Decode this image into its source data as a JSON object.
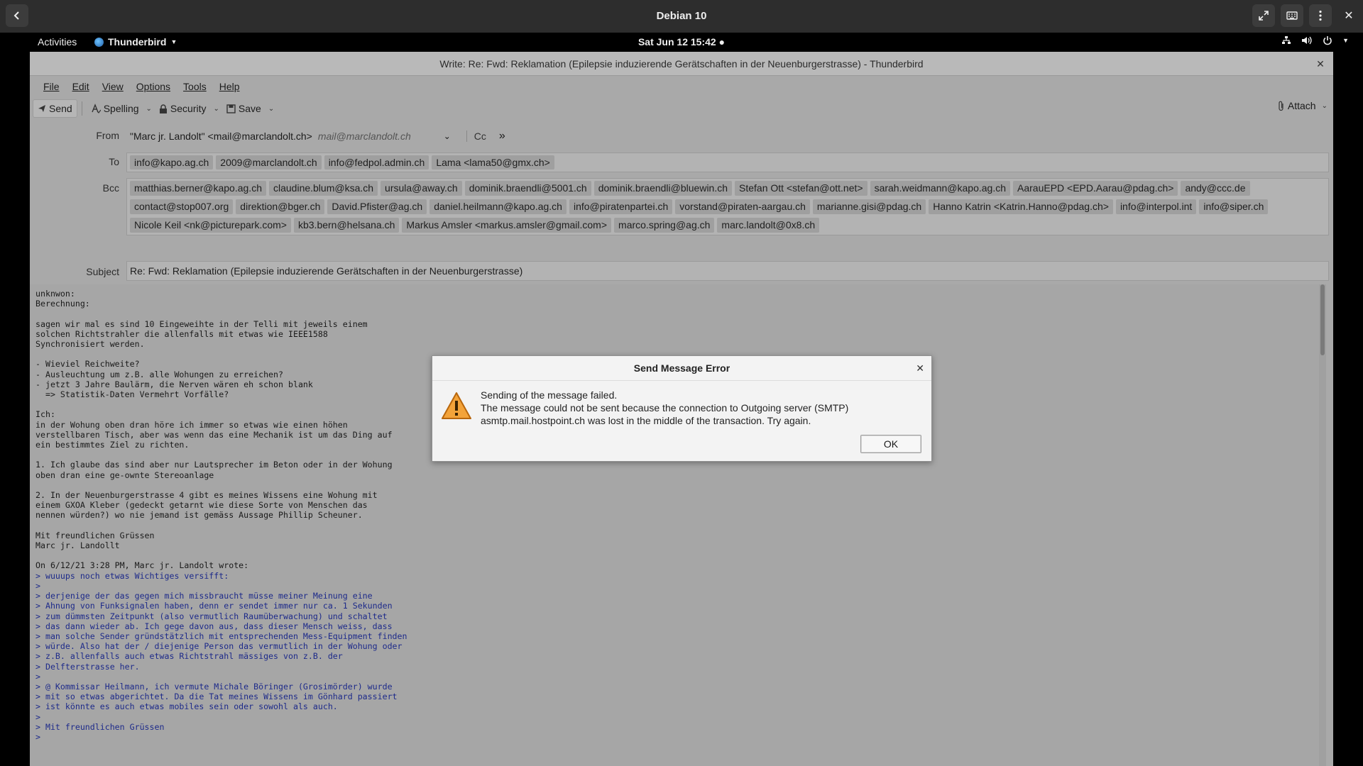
{
  "vm": {
    "title": "Debian 10"
  },
  "panel": {
    "activities": "Activities",
    "app": "Thunderbird",
    "clock": "Sat Jun 12  15:42"
  },
  "window": {
    "title": "Write: Re: Fwd: Reklamation (Epilepsie induzierende Gerätschaften in der Neuenburgerstrasse) - Thunderbird"
  },
  "menu": [
    "File",
    "Edit",
    "View",
    "Options",
    "Tools",
    "Help"
  ],
  "toolbar": {
    "send": "Send",
    "spelling": "Spelling",
    "security": "Security",
    "save": "Save",
    "attach": "Attach"
  },
  "headers": {
    "from_label": "From",
    "from_value": "\"Marc jr. Landolt\" <mail@marclandolt.ch>",
    "from_alt": "mail@marclandolt.ch",
    "cc": "Cc",
    "to_label": "To",
    "to": [
      "info@kapo.ag.ch",
      "2009@marclandolt.ch",
      "info@fedpol.admin.ch",
      "Lama <lama50@gmx.ch>"
    ],
    "bcc_label": "Bcc",
    "bcc": [
      "matthias.berner@kapo.ag.ch",
      "claudine.blum@ksa.ch",
      "ursula@away.ch",
      "dominik.braendli@5001.ch",
      "dominik.braendli@bluewin.ch",
      "Stefan Ott <stefan@ott.net>",
      "sarah.weidmann@kapo.ag.ch",
      "AarauEPD <EPD.Aarau@pdag.ch>",
      "andy@ccc.de",
      "contact@stop007.org",
      "direktion@bger.ch",
      "David.Pfister@ag.ch",
      "daniel.heilmann@kapo.ag.ch",
      "info@piratenpartei.ch",
      "vorstand@piraten-aargau.ch",
      "marianne.gisi@pdag.ch",
      "Hanno Katrin <Katrin.Hanno@pdag.ch>",
      "info@interpol.int",
      "info@siper.ch",
      "Nicole Keil <nk@picturepark.com>",
      "kb3.bern@helsana.ch",
      "Markus Amsler <markus.amsler@gmail.com>",
      "marco.spring@ag.ch",
      "marc.landolt@0x8.ch"
    ],
    "subject_label": "Subject",
    "subject": "Re: Fwd: Reklamation (Epilepsie induzierende Gerätschaften in der Neuenburgerstrasse)"
  },
  "body": {
    "plain": [
      "unknwon:",
      "Berechnung:",
      "",
      "sagen wir mal es sind 10 Eingeweihte in der Telli mit jeweils einem",
      "solchen Richtstrahler die allenfalls mit etwas wie IEEE1588",
      "Synchronisiert werden.",
      "",
      "- Wieviel Reichweite?",
      "- Ausleuchtung um z.B. alle Wohungen zu erreichen?",
      "- jetzt 3 Jahre Baulärm, die Nerven wären eh schon blank",
      "  => Statistik-Daten Vermehrt Vorfälle?",
      "",
      "Ich:",
      "in der Wohung oben dran höre ich immer so etwas wie einen höhen",
      "verstellbaren Tisch, aber was wenn das eine Mechanik ist um das Ding auf",
      "ein bestimmtes Ziel zu richten.",
      "",
      "1. Ich glaube das sind aber nur Lautsprecher im Beton oder in der Wohung",
      "oben dran eine ge-ownte Stereoanlage",
      "",
      "2. In der Neuenburgerstrasse 4 gibt es meines Wissens eine Wohung mit",
      "einem GXOA Kleber (gedeckt getarnt wie diese Sorte von Menschen das",
      "nennen würden?) wo nie jemand ist gemäss Aussage Phillip Scheuner.",
      "",
      "Mit freundlichen Grüssen",
      "Marc jr. Landollt",
      "",
      "On 6/12/21 3:28 PM, Marc jr. Landolt wrote:"
    ],
    "quoted": [
      "> wuuups noch etwas Wichtiges versifft:",
      ">",
      "> derjenige der das gegen mich missbraucht müsse meiner Meinung eine",
      "> Ahnung von Funksignalen haben, denn er sendet immer nur ca. 1 Sekunden",
      "> zum dümmsten Zeitpunkt (also vermutlich Raumüberwachung) und schaltet",
      "> das dann wieder ab. Ich gege davon aus, dass dieser Mensch weiss, dass",
      "> man solche Sender gründstätzlich mit entsprechenden Mess-Equipment finden",
      "> würde. Also hat der / diejenige Person das vermutlich in der Wohung oder",
      "> z.B. allenfalls auch etwas Richtstrahl mässiges von z.B. der",
      "> Delfterstrasse her.",
      ">",
      "> @ Kommissar Heilmann, ich vermute Michale Böringer (Grosimörder) wurde",
      "> mit so etwas abgerichtet. Da die Tat meines Wissens im Gönhard passiert",
      "> ist könnte es auch etwas mobiles sein oder sowohl als auch.",
      ">",
      "> Mit freundlichen Grüssen",
      ">"
    ]
  },
  "dialog": {
    "title": "Send Message Error",
    "line1": "Sending of the message failed.",
    "line2": "The message could not be sent because the connection to Outgoing server (SMTP)",
    "line3": "asmtp.mail.hostpoint.ch was lost in the middle of the transaction. Try again.",
    "ok": "OK"
  }
}
